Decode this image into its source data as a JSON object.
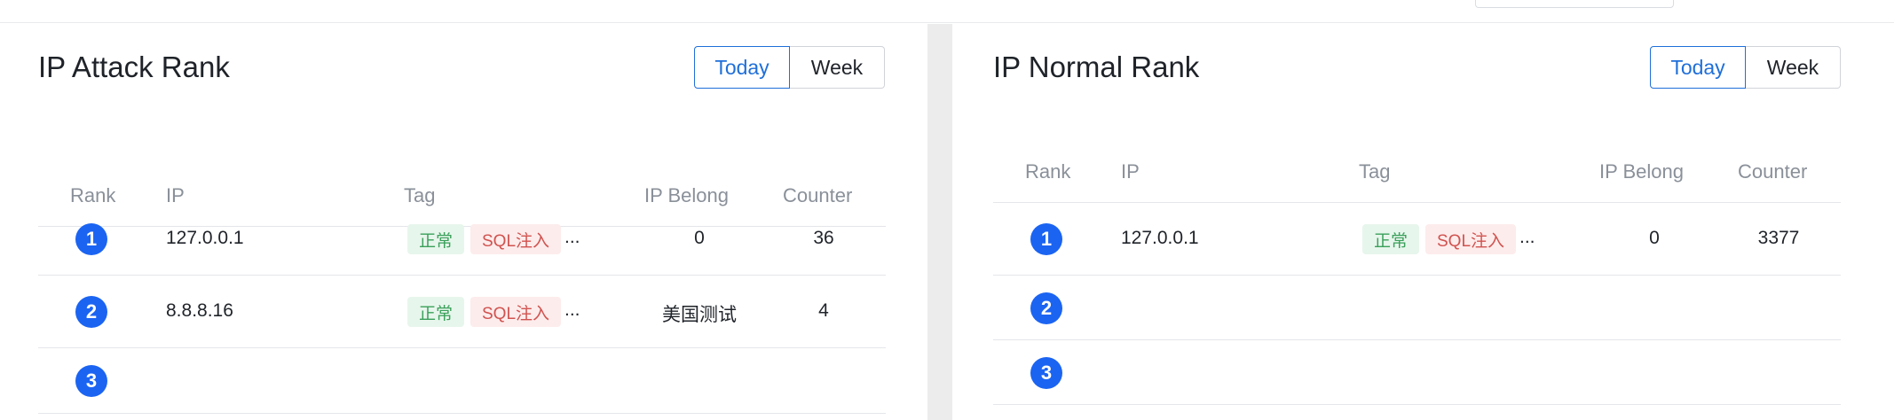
{
  "colors": {
    "accent": "#1f6fd9",
    "rank_badge": "#1b64f2",
    "tag_normal_bg": "#e7f6ec",
    "tag_normal_text": "#3aa05a",
    "tag_sql_bg": "#fdecec",
    "tag_sql_text": "#d0534f"
  },
  "attack_panel": {
    "title": "IP Attack Rank",
    "toggle": {
      "today": "Today",
      "week": "Week",
      "selected": "Today"
    },
    "columns": {
      "rank": "Rank",
      "ip": "IP",
      "tag": "Tag",
      "belong": "IP Belong",
      "counter": "Counter"
    },
    "rows": [
      {
        "rank": "1",
        "ip": "127.0.0.1",
        "tags": [
          "正常",
          "SQL注入"
        ],
        "more": "...",
        "belong": "0",
        "counter": "36"
      },
      {
        "rank": "2",
        "ip": "8.8.8.16",
        "tags": [
          "正常",
          "SQL注入"
        ],
        "more": "...",
        "belong": "美国测试",
        "counter": "4"
      },
      {
        "rank": "3"
      }
    ]
  },
  "normal_panel": {
    "title": "IP Normal Rank",
    "toggle": {
      "today": "Today",
      "week": "Week",
      "selected": "Today"
    },
    "columns": {
      "rank": "Rank",
      "ip": "IP",
      "tag": "Tag",
      "belong": "IP Belong",
      "counter": "Counter"
    },
    "rows": [
      {
        "rank": "1",
        "ip": "127.0.0.1",
        "tags": [
          "正常",
          "SQL注入"
        ],
        "more": "...",
        "belong": "0",
        "counter": "3377"
      },
      {
        "rank": "2"
      },
      {
        "rank": "3"
      }
    ]
  }
}
